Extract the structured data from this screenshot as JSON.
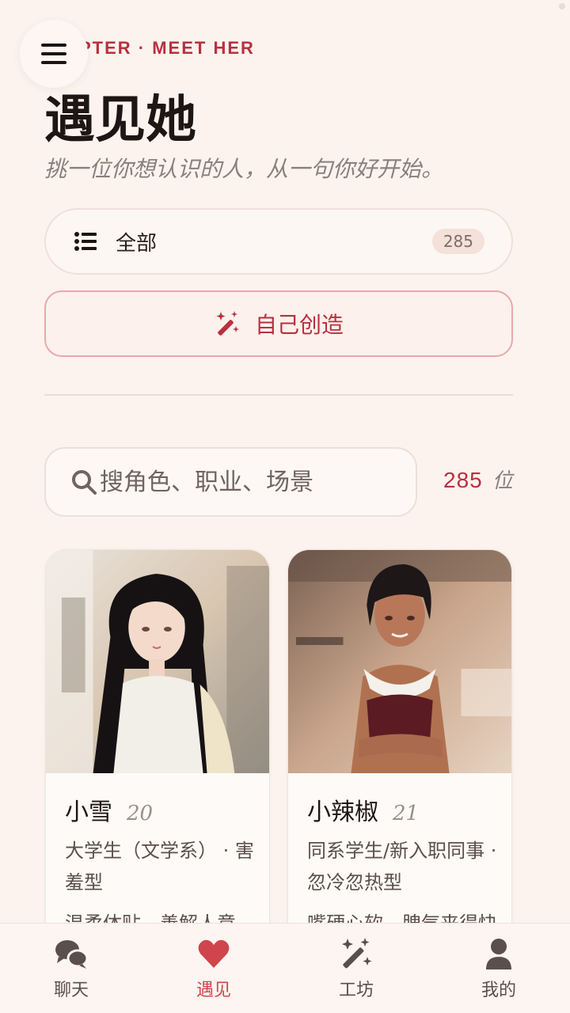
{
  "header": {
    "chapter": "PTER · MEET HER",
    "title": "遇见她",
    "subtitle": "挑一位你想认识的人，从一句你好开始。"
  },
  "filter": {
    "label": "全部",
    "count": "285"
  },
  "create": {
    "label": "自己创造"
  },
  "search": {
    "placeholder": "搜角色、职业、场景",
    "value": ""
  },
  "results": {
    "count": "285",
    "unit": "位"
  },
  "cards": [
    {
      "name": "小雪",
      "age": "20",
      "role": "大学生（文学系） · 害羞型",
      "desc": "温柔体贴，善解人意"
    },
    {
      "name": "小辣椒",
      "age": "21",
      "role": "同系学生/新入职同事 · 忽冷忽热型",
      "desc": "嘴硬心软，脾气来得快"
    }
  ],
  "tabs": [
    {
      "label": "聊天",
      "icon": "chat-icon"
    },
    {
      "label": "遇见",
      "icon": "heart-icon"
    },
    {
      "label": "工坊",
      "icon": "magic-wand-icon"
    },
    {
      "label": "我的",
      "icon": "user-icon"
    }
  ],
  "colors": {
    "accent": "#b8303f",
    "active_tab": "#d0454d",
    "background": "#fcf3ee"
  }
}
